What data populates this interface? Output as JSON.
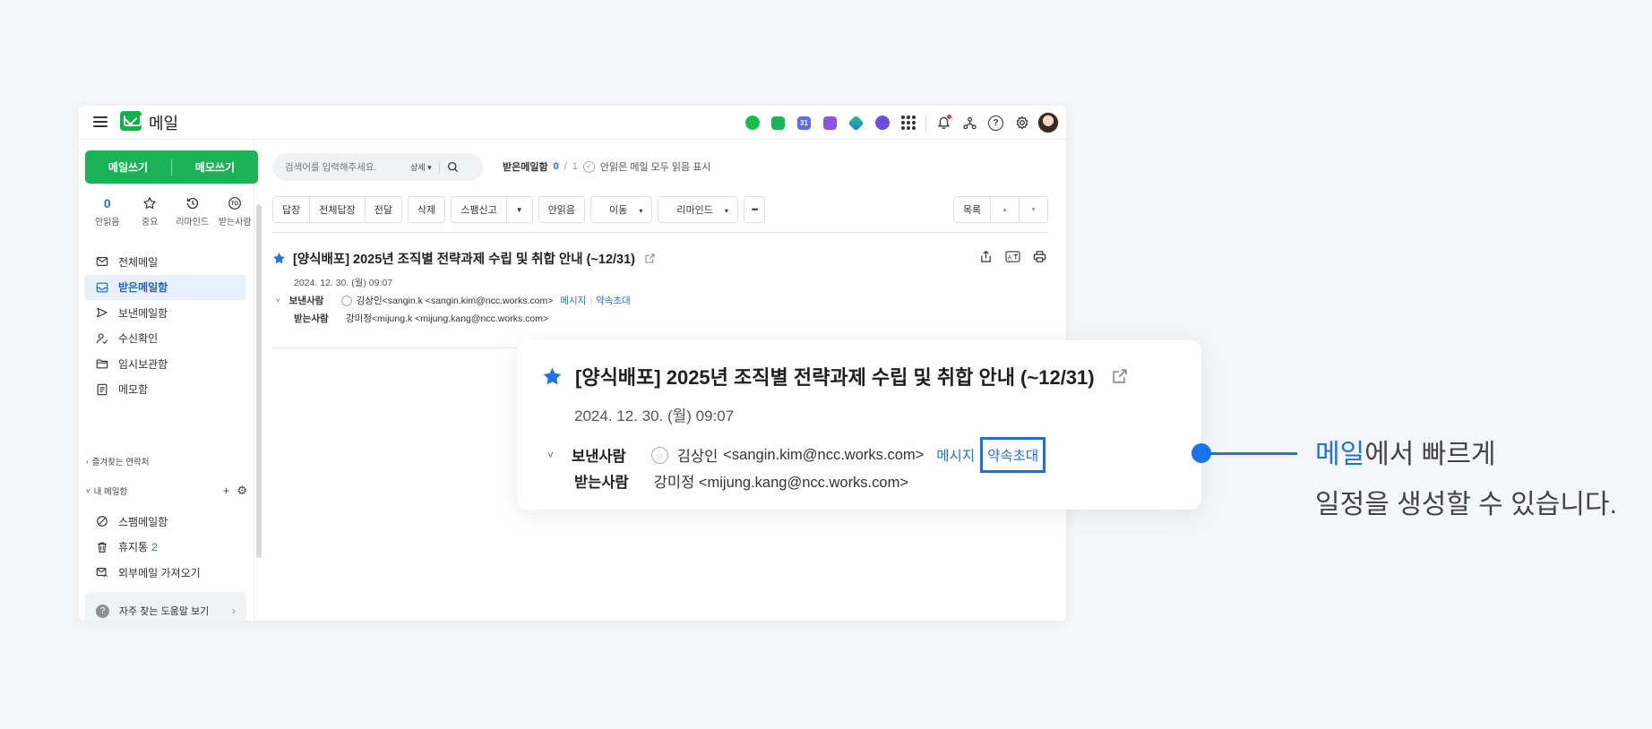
{
  "app": {
    "title": "메일"
  },
  "sidebar": {
    "compose_label": "메일쓰기",
    "memo_label": "메모쓰기",
    "quick": [
      {
        "value": "0",
        "label": "안읽음"
      },
      {
        "label": "중요"
      },
      {
        "label": "리마인드"
      },
      {
        "label": "받는사람"
      }
    ],
    "folders": [
      {
        "label": "전체메일",
        "icon": "mail-icon"
      },
      {
        "label": "받은메일함",
        "icon": "inbox-icon",
        "active": true
      },
      {
        "label": "보낸메일함",
        "icon": "send-icon"
      },
      {
        "label": "수신확인",
        "icon": "read-receipt-icon"
      },
      {
        "label": "임시보관함",
        "icon": "folder-icon"
      },
      {
        "label": "메모함",
        "icon": "memo-icon"
      }
    ],
    "favorites_label": "즐겨찾는 연락처",
    "my_mailboxes_label": "내 메일함",
    "folders2": [
      {
        "label": "스팸메일함",
        "icon": "spam-icon"
      },
      {
        "label": "휴지통",
        "count": "2",
        "icon": "trash-icon"
      },
      {
        "label": "외부메일 가져오기",
        "icon": "external-mail-icon"
      }
    ],
    "help_label": "자주 찾는 도움말 보기"
  },
  "search": {
    "placeholder": "검색어를 입력해주세요.",
    "detail_label": "상세"
  },
  "inbox_info": {
    "label": "받은메일함",
    "unread": "0",
    "sep": "/",
    "total": "1",
    "mark_read_label": "안읽은 메일 모두 읽음 표시"
  },
  "toolbar": {
    "reply": "답장",
    "reply_all": "전체답장",
    "forward": "전달",
    "delete": "삭제",
    "spam": "스팸신고",
    "unread": "안읽음",
    "move": "이동",
    "remind": "리마인드",
    "more": "•••",
    "list": "목록"
  },
  "message": {
    "subject": "[양식배포] 2025년 조직별 전략과제 수립 및 취합 안내 (~12/31)",
    "date": "2024. 12. 30. (월) 09:07",
    "sender_label": "보낸사람",
    "sender_small": "김상인<sangin.k <sangin.kim@ncc.works.com>",
    "sender_name": "김상인",
    "sender_email": "<sangin.kim@ncc.works.com>",
    "recipient_label": "받는사람",
    "recipient_small": "강미정<mijung.k <mijung.kang@ncc.works.com>",
    "recipient": "강미정 <mijung.kang@ncc.works.com>",
    "message_link": "메시지",
    "invite_link": "약속초대"
  },
  "callout": {
    "highlight": "메일",
    "line1_rest": "에서 빠르게",
    "line2": "일정을 생성할 수 있습니다."
  },
  "colors": {
    "accent": "#1a73e8",
    "brand_green": "#1bb156",
    "active_bg": "#e8f0fd"
  }
}
